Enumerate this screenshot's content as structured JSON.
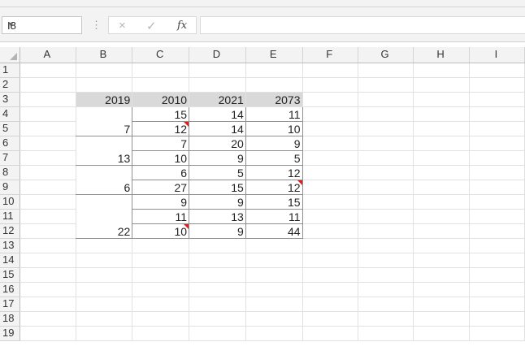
{
  "namebox": {
    "value": "I8"
  },
  "formula": {
    "value": ""
  },
  "columns": [
    "A",
    "B",
    "C",
    "D",
    "E",
    "F",
    "G",
    "H",
    "I"
  ],
  "rows": [
    "1",
    "2",
    "3",
    "4",
    "5",
    "6",
    "7",
    "8",
    "9",
    "10",
    "11",
    "12",
    "13",
    "14",
    "15",
    "16",
    "17",
    "18",
    "19"
  ],
  "header_row": {
    "B": "2019",
    "C": "2010",
    "D": "2021",
    "E": "2073"
  },
  "group_labels": [
    "7",
    "13",
    "6",
    "22"
  ],
  "data": [
    {
      "C": "15",
      "D": "14",
      "E": "11"
    },
    {
      "C": "12",
      "D": "14",
      "E": "10"
    },
    {
      "C": "7",
      "D": "20",
      "E": "9"
    },
    {
      "C": "10",
      "D": "9",
      "E": "5"
    },
    {
      "C": "6",
      "D": "5",
      "E": "12"
    },
    {
      "C": "27",
      "D": "15",
      "E": "12"
    },
    {
      "C": "9",
      "D": "9",
      "E": "15"
    },
    {
      "C": "11",
      "D": "13",
      "E": "11"
    },
    {
      "C": "10",
      "D": "9",
      "E": "44"
    }
  ],
  "icons": {
    "cancel": "×",
    "enter": "✓",
    "function": "fx",
    "dropdown": "▼"
  }
}
